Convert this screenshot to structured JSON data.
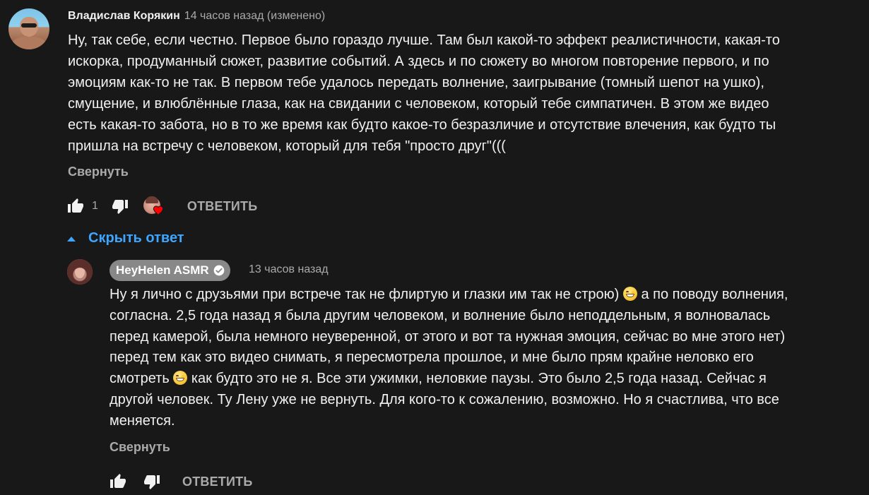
{
  "comment": {
    "author": "Владислав Корякин",
    "time": "14 часов назад (изменено)",
    "lines": [
      "Ну, так себе, если честно. Первое было гораздо лучше. Там был какой-то эффект реалистичности, какая-то",
      "искорка, продуманный сюжет, развитие событий. А здесь и по сюжету во многом повторение первого, и по",
      "эмоциям как-то не так. В первом тебе удалось передать волнение, заигрывание (томный шепот на ушко),",
      "смущение, и влюблённые глаза, как на свидании с человеком, который тебе симпатичен. В этом же видео",
      "есть какая-то забота, но в то же время как будто какое-то безразличие и отсутствие влечения, как будто ты",
      "пришла на встречу с человеком, который для тебя \"просто друг\"((("
    ],
    "collapse_label": "Свернуть",
    "like_count": "1",
    "reply_label": "ОТВЕТИТЬ",
    "icons": {
      "like": "thumb-up-icon",
      "dislike": "thumb-down-icon",
      "creator_heart": "creator-heart-icon"
    }
  },
  "replies_toggle": {
    "label": "Скрыть ответ",
    "icon": "caret-up-icon"
  },
  "reply": {
    "channel": "HeyHelen ASMR",
    "verified_icon": "verified-check-icon",
    "time": "13 часов назад",
    "lines": [
      {
        "before": "Ну я лично с друзьями при встрече так не флиртую и глазки им так не строю) ",
        "emoji": "grinning-face",
        "after": " а по поводу волнения,"
      },
      {
        "before": "согласна. 2,5 года назад я была другим человеком, и волнение было неподдельным, я волновалась"
      },
      {
        "before": "перед камерой, была немного неуверенной, от этого и вот та нужная эмоция, сейчас во мне этого нет)"
      },
      {
        "before": "перед тем как это видео снимать, я пересмотрела прошлое, и мне было прям крайне неловко его"
      },
      {
        "before": "смотреть ",
        "emoji": "grinning-face",
        "after": " как будто это не я. Все эти ужимки, неловкие паузы. Это было 2,5 года назад. Сейчас я"
      },
      {
        "before": "другой человек.  Ту Лену уже не вернуть. Для кого-то к сожалению, возможно. Но я счастлива, что все"
      },
      {
        "before": "меняется."
      }
    ],
    "collapse_label": "Свернуть",
    "reply_label": "ОТВЕТИТЬ"
  },
  "colors": {
    "background": "#181818",
    "text": "#f1f1f1",
    "secondary": "#aaaaaa",
    "link": "#3ea6ff",
    "heart": "#ff0000",
    "channel_pill": "#888888"
  }
}
